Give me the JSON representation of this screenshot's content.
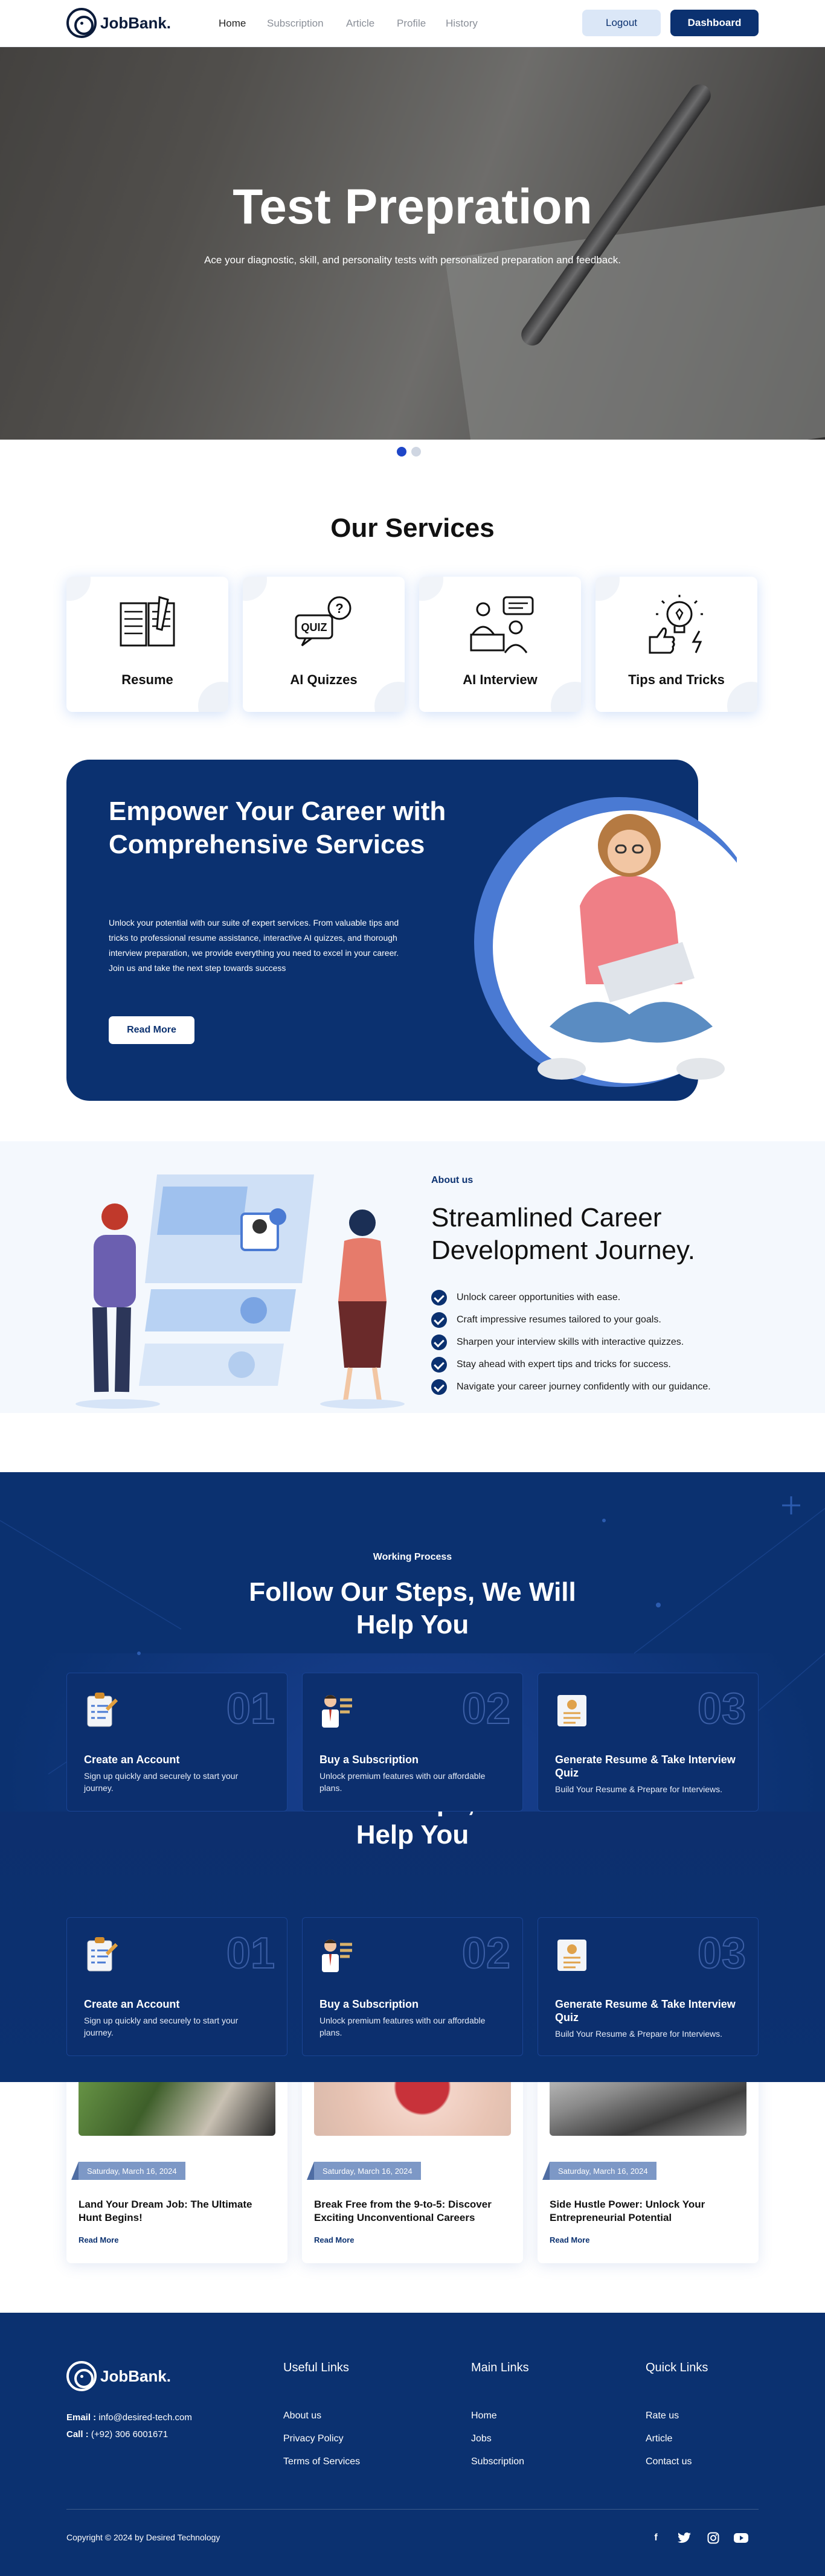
{
  "header": {
    "brand": "JobBank.",
    "nav": [
      "Home",
      "Subscription",
      "Article",
      "Profile",
      "History"
    ],
    "logout": "Logout",
    "dashboard": "Dashboard"
  },
  "hero": {
    "title": "Test Prepration",
    "subtitle": "Ace your diagnostic, skill, and personality tests with personalized preparation and feedback."
  },
  "services": {
    "heading": "Our Services",
    "items": [
      "Resume",
      "AI Quizzes",
      "AI Interview",
      "Tips and Tricks"
    ],
    "quiz_icon_text": "QUIZ"
  },
  "empower": {
    "title": "Empower Your Career with Comprehensive Services",
    "body": "Unlock your potential with our suite of expert services. From valuable tips and tricks to professional resume assistance, interactive AI quizzes, and thorough interview preparation, we provide everything you need to excel in your career. Join us and take the next step towards success",
    "button": "Read More"
  },
  "about": {
    "eyebrow": "About us",
    "title": "Streamlined Career Development Journey.",
    "points": [
      "Unlock career opportunities with ease.",
      "Craft impressive resumes tailored to your goals.",
      "Sharpen your interview skills with interactive quizzes.",
      "Stay ahead with expert tips and tricks for success.",
      "Navigate your career journey confidently with our guidance."
    ]
  },
  "working": {
    "eyebrow": "Working Process",
    "title": "Follow Our Steps, We Will Help You",
    "steps": [
      {
        "num": "01",
        "title": "Create an Account",
        "desc": "Sign up quickly and securely to start your journey."
      },
      {
        "num": "02",
        "title": "Buy a Subscription",
        "desc": "Unlock premium features with our affordable plans."
      },
      {
        "num": "03",
        "title": "Generate Resume & Take Interview Quiz",
        "desc": "Build Your Resume & Prepare for Interviews."
      }
    ]
  },
  "blog": [
    {
      "date": "Saturday, March 16, 2024",
      "title": "Land Your Dream Job: The Ultimate Hunt Begins!",
      "more": "Read More"
    },
    {
      "date": "Saturday, March 16, 2024",
      "title": "Break Free from the 9-to-5: Discover Exciting Unconventional Careers",
      "more": "Read More"
    },
    {
      "date": "Saturday, March 16, 2024",
      "title": "Side Hustle Power: Unlock Your Entrepreneurial Potential",
      "more": "Read More"
    }
  ],
  "footer": {
    "brand": "JobBank.",
    "email_label": "Email :",
    "email": "info@desired-tech.com",
    "call_label": "Call :",
    "phone": "(+92) 306 6001671",
    "useful": {
      "heading": "Useful Links",
      "links": [
        "About us",
        "Privacy Policy",
        "Terms of Services"
      ]
    },
    "main": {
      "heading": "Main Links",
      "links": [
        "Home",
        "Jobs",
        "Subscription"
      ]
    },
    "quick": {
      "heading": "Quick Links",
      "links": [
        "Rate us",
        "Article",
        "Contact us"
      ]
    },
    "copyright": "Copyright © 2024 by Desired Technology",
    "social": [
      "facebook-icon",
      "twitter-icon",
      "instagram-icon",
      "youtube-icon"
    ]
  },
  "colors": {
    "primary": "#0b3170",
    "accent": "#3a6fd8",
    "light_bg": "#f4f8fd"
  }
}
